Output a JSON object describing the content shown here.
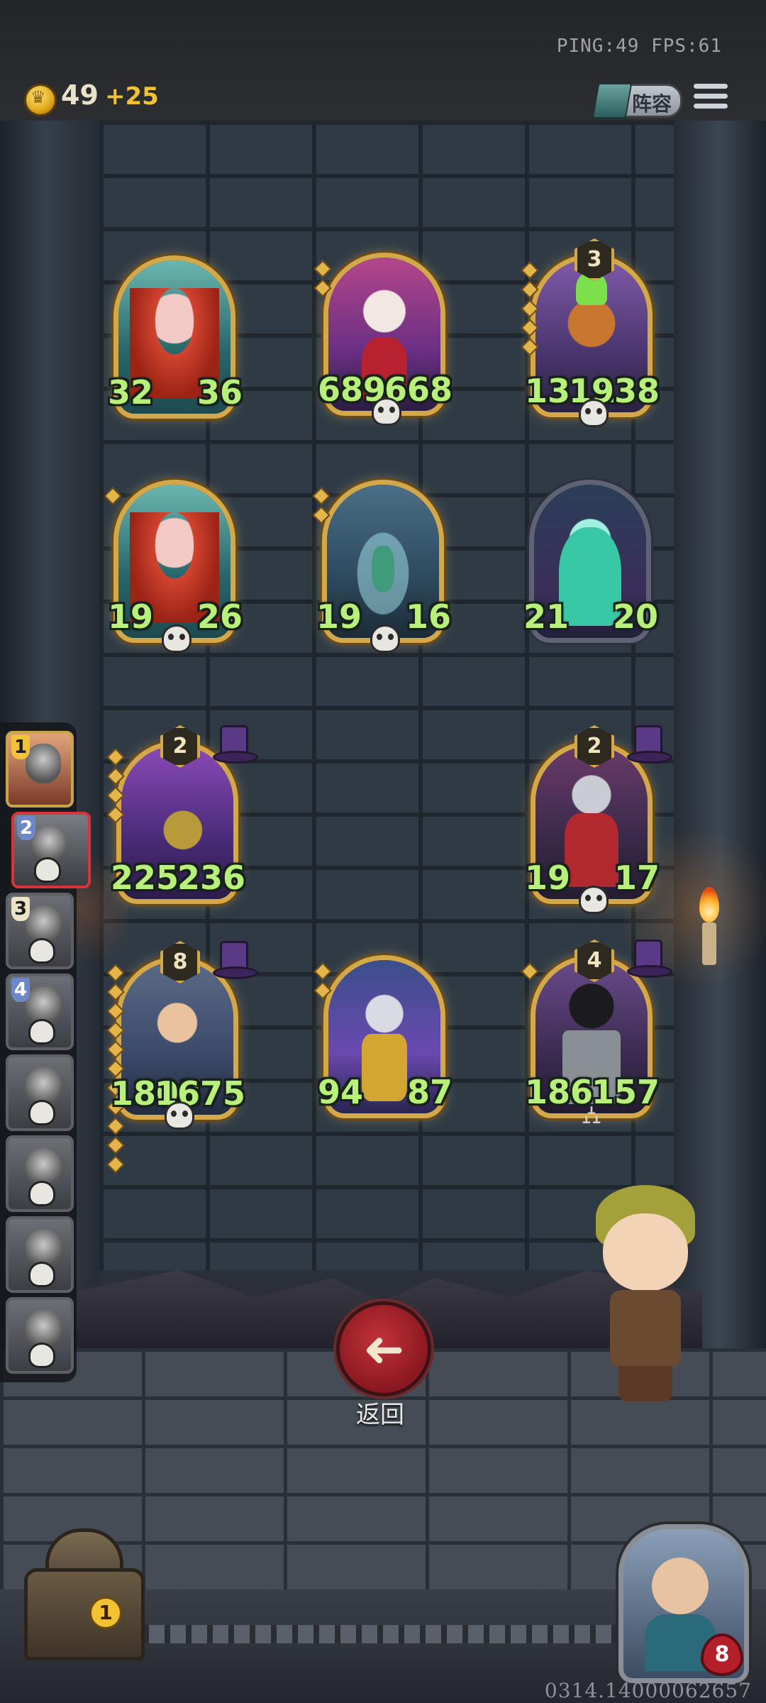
{
  "header": {
    "ping_fps": "PING:49  FPS:61",
    "gold": "49",
    "gold_income": "+25",
    "lineup_label": "阵容"
  },
  "board": {
    "row1": [
      {
        "tier": "",
        "attack": "32",
        "health": "36"
      },
      {
        "tier": "",
        "attack": "689",
        "health": "668"
      },
      {
        "tier": "3",
        "attack": "1311",
        "health": "1938"
      }
    ],
    "row2": [
      {
        "tier": "",
        "attack": "19",
        "health": "26"
      },
      {
        "tier": "",
        "attack": "19",
        "health": "16"
      },
      {
        "tier": "",
        "attack": "21",
        "health": "20"
      }
    ],
    "row3": [
      {
        "tier": "2",
        "attack": "225",
        "health": "236"
      },
      {
        "tier": "2",
        "attack": "19",
        "health": "17"
      }
    ],
    "row4": [
      {
        "tier": "8",
        "attack": "1803",
        "health": "1675"
      },
      {
        "tier": "",
        "attack": "94",
        "health": "87"
      },
      {
        "tier": "4",
        "attack": "186",
        "health": "157"
      }
    ]
  },
  "shop_slots": [
    "1",
    "2",
    "3",
    "4"
  ],
  "back_label": "返回",
  "chest_count": "1",
  "hero_health": "8",
  "build_id": "0314.14000062657"
}
